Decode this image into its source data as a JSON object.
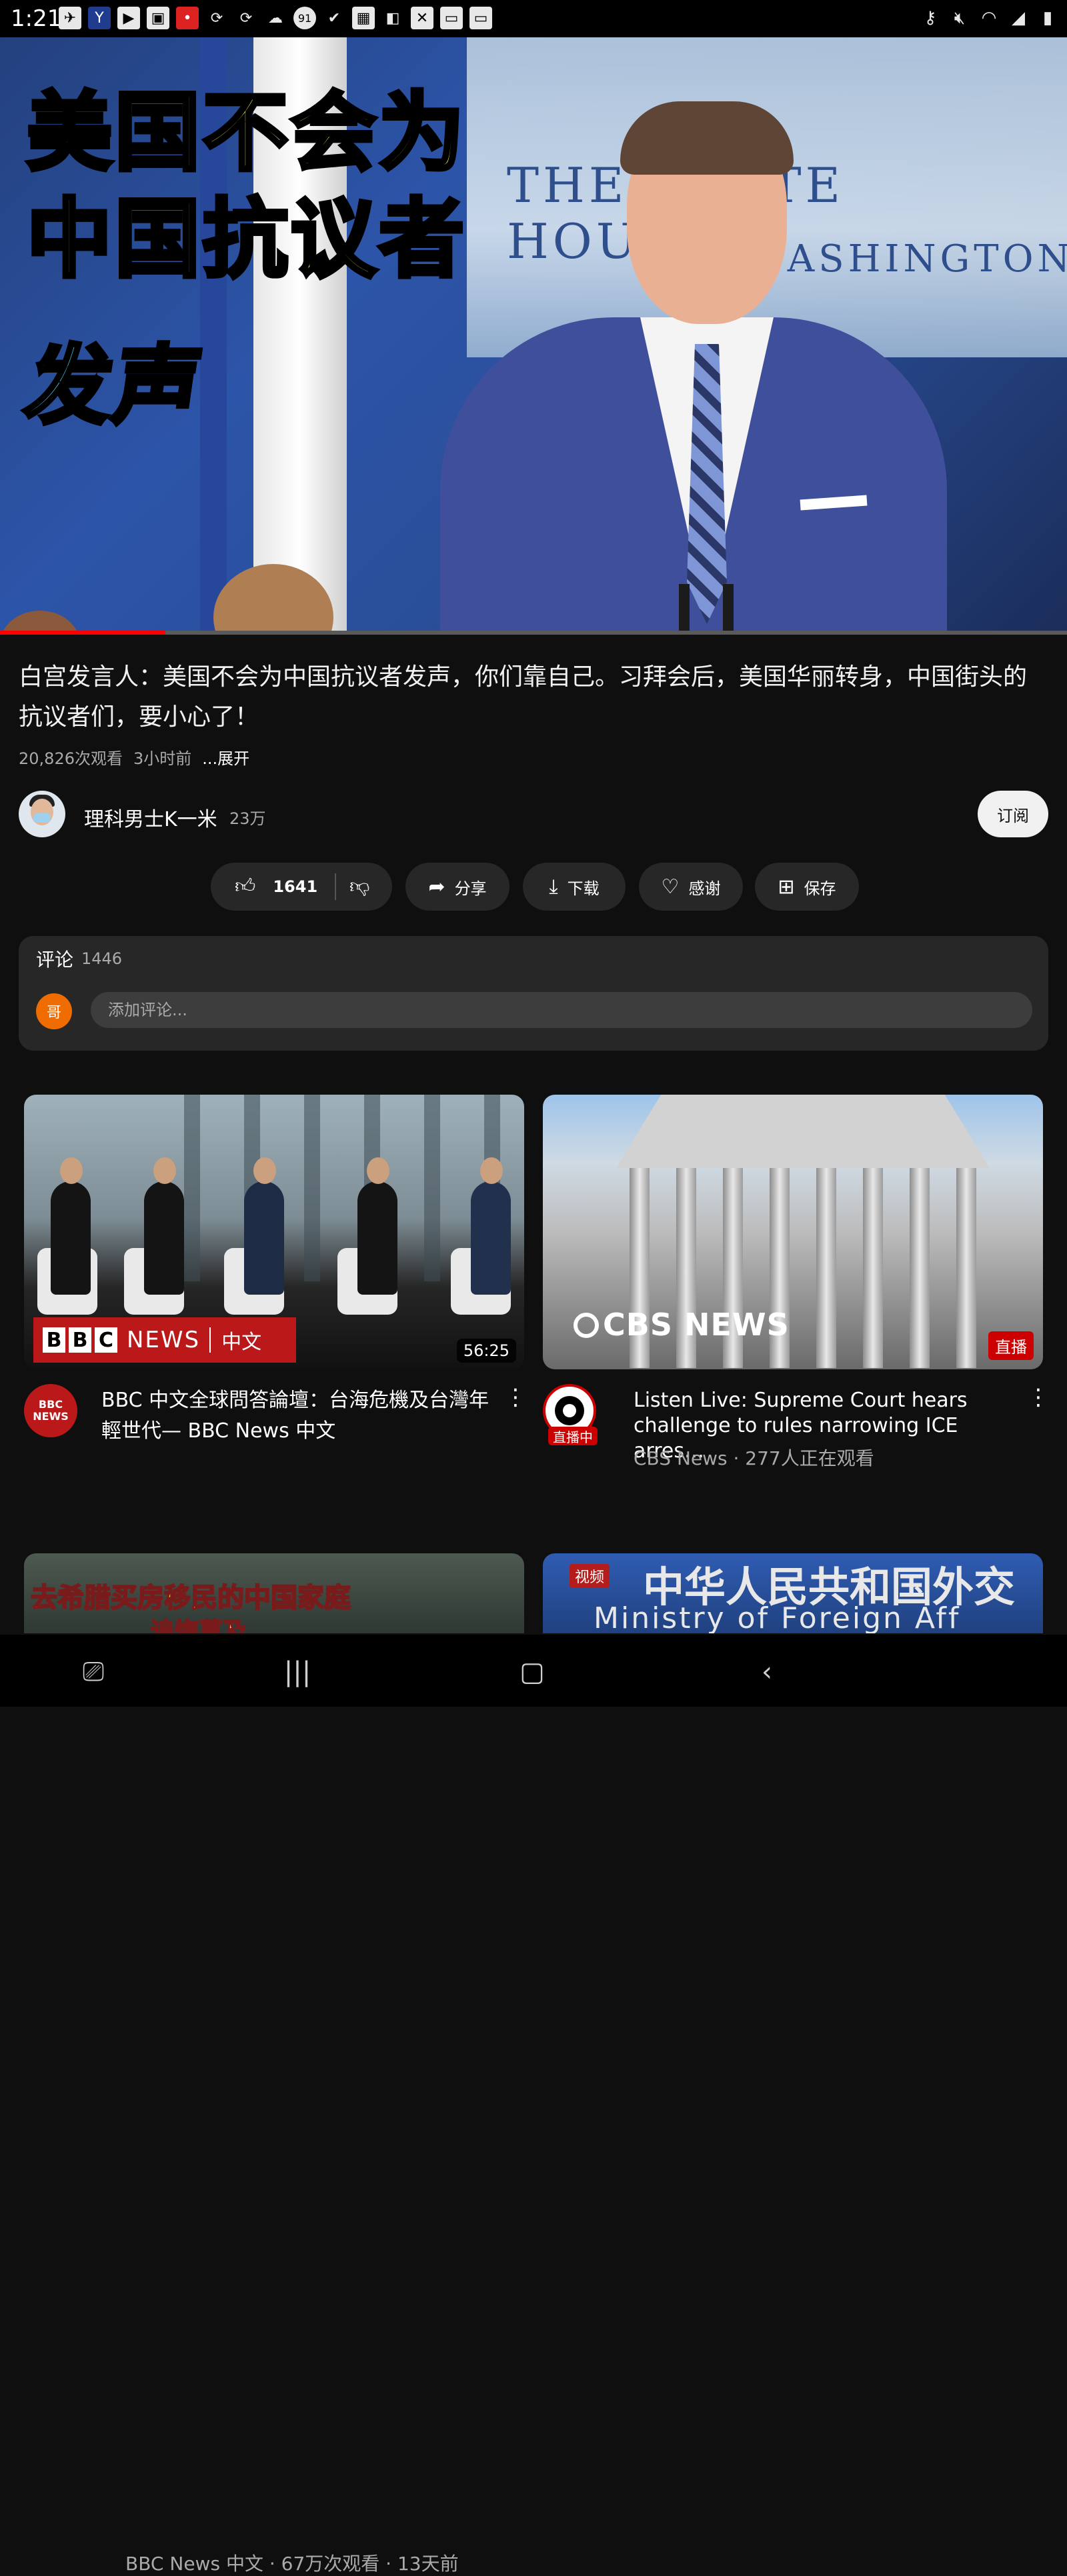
{
  "status_bar": {
    "time": "1:21",
    "left_icons": [
      "notification-icon",
      "app-icon",
      "youtube-icon",
      "photo-icon",
      "app-red-icon",
      "refresh-icon",
      "refresh-icon",
      "cloud-icon",
      "badge-91-icon",
      "check-icon",
      "image-icon",
      "bag-icon",
      "close-box-icon",
      "window-icon",
      "window-icon"
    ],
    "right_icons": [
      "key-icon",
      "mute-icon",
      "wifi-icon",
      "signal-icon",
      "battery-icon"
    ]
  },
  "player": {
    "overlay_line1": "美国不会为",
    "overlay_line2": "中国抗议者",
    "overlay_line3": "发声",
    "backdrop_text1": "THE WHITE HOUSE",
    "backdrop_text2": "WASHINGTON",
    "progress_fraction": 0.155
  },
  "video": {
    "title": "白宫发言人：美国不会为中国抗议者发声，你们靠自己。习拜会后，美国华丽转身，中国街头的抗议者们，要小心了！",
    "views": "20,826次观看",
    "age": "3小时前",
    "expand": "...展开"
  },
  "channel": {
    "name": "理科男士K一米",
    "subscribers": "23万",
    "subscribe_label": "订阅"
  },
  "actions": {
    "likes": "1641",
    "share": "分享",
    "download": "下载",
    "thanks": "感谢",
    "save": "保存"
  },
  "comments": {
    "title": "评论",
    "count": "1446",
    "avatar_letter": "哥",
    "placeholder": "添加评论..."
  },
  "recommendations": [
    {
      "title": "BBC 中文全球問答論壇：台海危機及台灣年輕世代— BBC News 中文",
      "meta": "BBC News 中文 · 67万次观看 · 13天前",
      "duration": "56:25",
      "logo_news": "NEWS",
      "logo_zh": "中文",
      "channel_avatar_text": "BBC NEWS"
    },
    {
      "title": "Listen Live: Supreme Court hears challenge to rules narrowing ICE arres…",
      "meta": "CBS News · 277人正在观看",
      "live_badge": "直播",
      "live_avatar_badge": "直播中",
      "logo_text": "CBS NEWS"
    }
  ],
  "next_row": {
    "left_line1": "去希腊买房移民的中国家庭",
    "left_line2": "追悔莫及",
    "right_badge": "视频",
    "right_cn": "中华人民共和国外交",
    "right_en": "Ministry of Foreign Aff"
  }
}
